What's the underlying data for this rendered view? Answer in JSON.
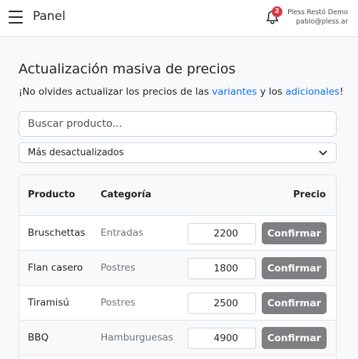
{
  "header": {
    "brand": "Panel",
    "notifications_count": "2",
    "user_name": "Pless Restó Demo",
    "user_email": "pablo@pless.ar"
  },
  "main": {
    "title": "Actualización masiva de precios",
    "reminder": {
      "prefix": "¡No olvides actualizar los precios de las ",
      "link_variants": "variantes",
      "middle": " y los ",
      "link_extras": "adicionales",
      "suffix": "!"
    },
    "search_placeholder": "Buscar producto...",
    "sort_selected": "Más desactualizados"
  },
  "table": {
    "headers": {
      "product": "Producto",
      "category": "Categoría",
      "price": "Precio"
    },
    "confirm_label": "Confirmar",
    "rows": [
      {
        "product": "Bruschettas",
        "category": "Entradas",
        "price": "2200"
      },
      {
        "product": "Flan casero",
        "category": "Postres",
        "price": "1800"
      },
      {
        "product": "Tiramisú",
        "category": "Postres",
        "price": "2500"
      },
      {
        "product": "BBQ",
        "category": "Hamburguesas",
        "price": "4900"
      }
    ]
  },
  "colors": {
    "link": "#0d6efd",
    "badge": "#dc3545",
    "confirm_button": "#7d7f82"
  }
}
